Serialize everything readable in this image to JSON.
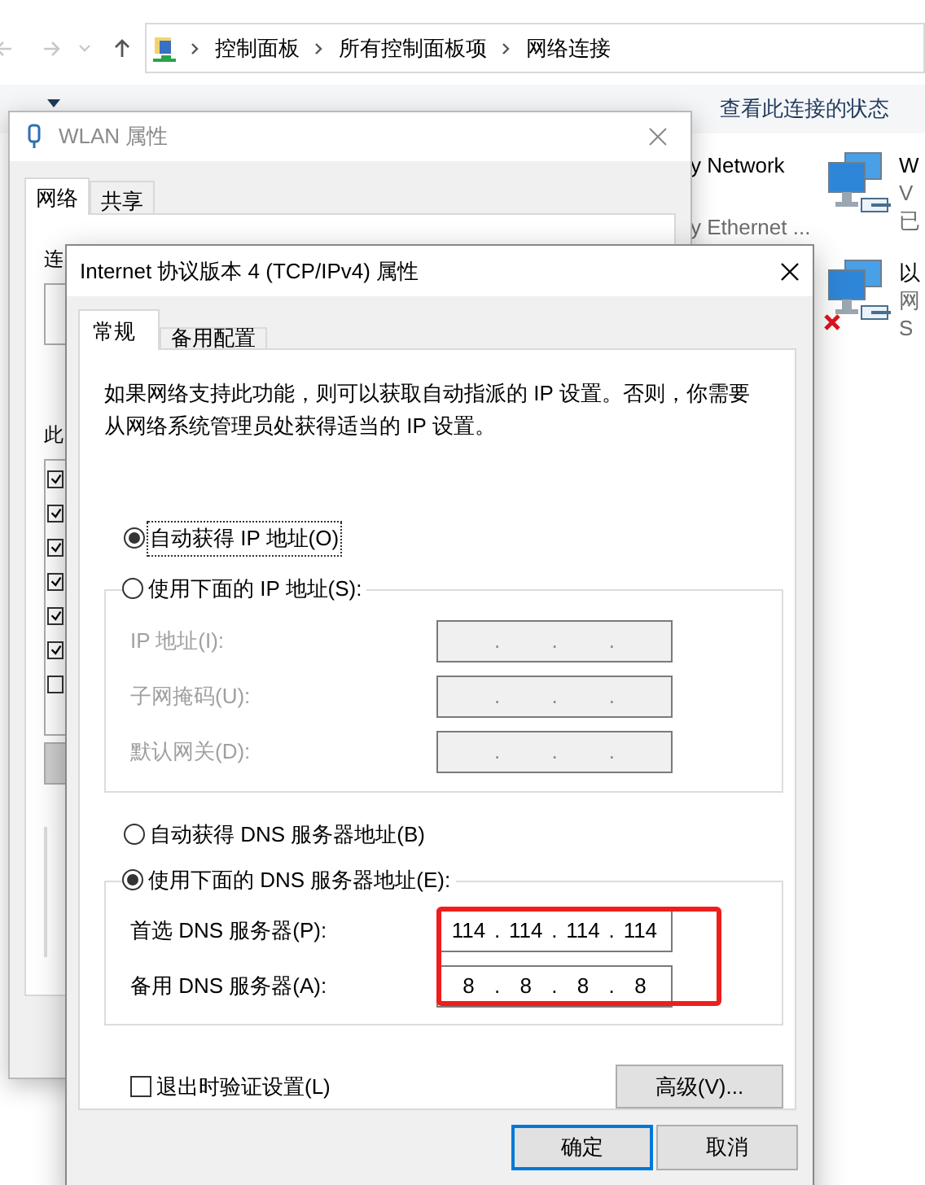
{
  "explorer": {
    "breadcrumb": [
      "控制面板",
      "所有控制面板项",
      "网络连接"
    ],
    "toolbar": [
      {
        "label": "查看此连接的状态"
      }
    ],
    "partial_connection": [
      "y Network",
      "y Ethernet ..."
    ],
    "connections": [
      {
        "lines": [
          "W",
          "V",
          "已"
        ],
        "disconnected": false
      },
      {
        "lines": [
          "以",
          "网",
          "S"
        ],
        "disconnected": true
      }
    ]
  },
  "wlan_dialog": {
    "title": "WLAN 属性",
    "active": false,
    "tabs": [
      {
        "label": "网络",
        "selected": true
      },
      {
        "label": "共享",
        "selected": false
      }
    ],
    "labels": [
      "连",
      "此"
    ],
    "list_items": [
      {
        "checked": true
      },
      {
        "checked": true
      },
      {
        "checked": true
      },
      {
        "checked": true
      },
      {
        "checked": true
      },
      {
        "checked": true
      },
      {
        "checked": false
      }
    ]
  },
  "ipv4_dialog": {
    "title": "Internet 协议版本 4 (TCP/IPv4) 属性",
    "active": true,
    "tabs": [
      {
        "label": "常规",
        "selected": true
      },
      {
        "label": "备用配置",
        "selected": false
      }
    ],
    "description": "如果网络支持此功能，则可以获取自动指派的 IP 设置。否则，你需要从网络系统管理员处获得适当的 IP 设置。",
    "ip_mode": [
      {
        "label": "自动获得 IP 地址(O)",
        "selected": true,
        "focused": true
      },
      {
        "label": "使用下面的 IP 地址(S):",
        "selected": false,
        "focused": false
      }
    ],
    "ip_fields": [
      {
        "label": "IP 地址(I):",
        "parts": [
          ".",
          ".",
          "."
        ],
        "disabled": true
      },
      {
        "label": "子网掩码(U):",
        "parts": [
          ".",
          ".",
          "."
        ],
        "disabled": true
      },
      {
        "label": "默认网关(D):",
        "parts": [
          ".",
          ".",
          "."
        ],
        "disabled": true
      }
    ],
    "dns_mode": [
      {
        "label": "自动获得 DNS 服务器地址(B)",
        "selected": false,
        "focused": false
      },
      {
        "label": "使用下面的 DNS 服务器地址(E):",
        "selected": true,
        "focused": false
      }
    ],
    "dns_fields": [
      {
        "label": "首选 DNS 服务器(P):",
        "parts": [
          "114",
          ".",
          "114",
          ".",
          "114",
          ".",
          "114"
        ],
        "disabled": false
      },
      {
        "label": "备用 DNS 服务器(A):",
        "parts": [
          "8",
          ".",
          "8",
          ".",
          "8",
          ".",
          "8"
        ],
        "disabled": false
      }
    ],
    "dns_highlight": true,
    "validate_on_exit": {
      "label": "退出时验证设置(L)",
      "checked": false
    },
    "advanced_button": "高级(V)...",
    "buttons": [
      {
        "label": "确定",
        "default": true
      },
      {
        "label": "取消",
        "default": false
      }
    ]
  }
}
